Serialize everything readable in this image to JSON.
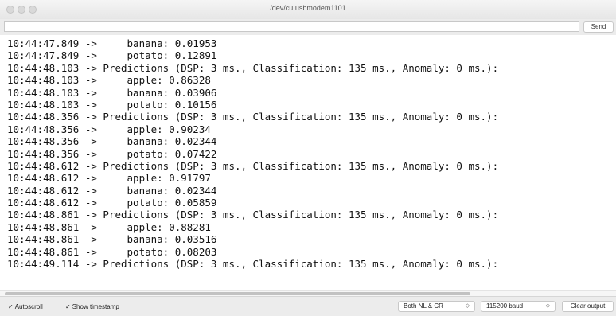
{
  "window": {
    "title": "/dev/cu.usbmodem1101"
  },
  "input_row": {
    "send_label": "Send"
  },
  "console": {
    "lines": [
      "10:44:47.849 ->     banana: 0.01953",
      "10:44:47.849 ->     potato: 0.12891",
      "10:44:48.103 -> Predictions (DSP: 3 ms., Classification: 135 ms., Anomaly: 0 ms.):",
      "10:44:48.103 ->     apple: 0.86328",
      "10:44:48.103 ->     banana: 0.03906",
      "10:44:48.103 ->     potato: 0.10156",
      "10:44:48.356 -> Predictions (DSP: 3 ms., Classification: 135 ms., Anomaly: 0 ms.):",
      "10:44:48.356 ->     apple: 0.90234",
      "10:44:48.356 ->     banana: 0.02344",
      "10:44:48.356 ->     potato: 0.07422",
      "10:44:48.612 -> Predictions (DSP: 3 ms., Classification: 135 ms., Anomaly: 0 ms.):",
      "10:44:48.612 ->     apple: 0.91797",
      "10:44:48.612 ->     banana: 0.02344",
      "10:44:48.612 ->     potato: 0.05859",
      "10:44:48.861 -> Predictions (DSP: 3 ms., Classification: 135 ms., Anomaly: 0 ms.):",
      "10:44:48.861 ->     apple: 0.88281",
      "10:44:48.861 ->     banana: 0.03516",
      "10:44:48.861 ->     potato: 0.08203",
      "10:44:49.114 -> Predictions (DSP: 3 ms., Classification: 135 ms., Anomaly: 0 ms.):"
    ]
  },
  "bottom_bar": {
    "autoscroll_label": "Autoscroll",
    "autoscroll_checked": true,
    "show_timestamp_label": "Show timestamp",
    "show_timestamp_checked": true,
    "line_ending": "Both NL & CR",
    "baud_rate": "115200 baud",
    "clear_label": "Clear output"
  },
  "icons": {
    "checkmark": "✓",
    "chevron": "⌃⌄"
  }
}
